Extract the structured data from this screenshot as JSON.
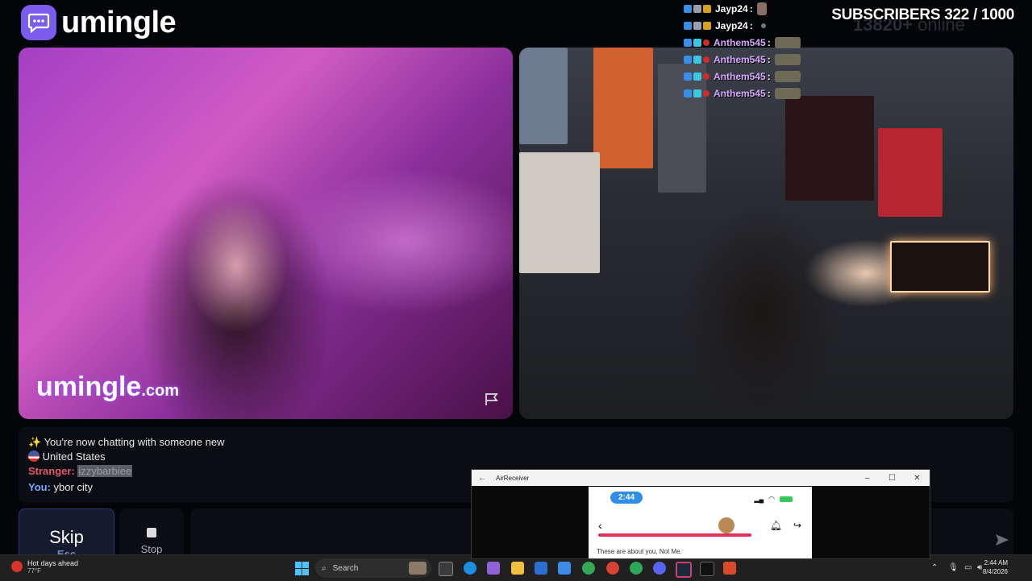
{
  "header": {
    "brand": "umingle",
    "online_count": "13820+",
    "online_word": "online",
    "subscribers": "SUBSCRIBERS 322 / 1000"
  },
  "overlay_chat": [
    {
      "name": "Jayp24",
      "sep": ":",
      "color": "#ffffff"
    },
    {
      "name": "Jayp24",
      "sep": ":",
      "color": "#ffffff"
    },
    {
      "name": "Anthem545",
      "sep": ":",
      "color": "#d9a8ff"
    },
    {
      "name": "Anthem545",
      "sep": ":",
      "color": "#d9a8ff"
    },
    {
      "name": "Anthem545",
      "sep": ":",
      "color": "#d9a8ff"
    },
    {
      "name": "Anthem545",
      "sep": ":",
      "color": "#d9a8ff"
    }
  ],
  "video_left": {
    "watermark_main": "umingle",
    "watermark_suffix": ".com",
    "report_icon": "flag-icon"
  },
  "chat": {
    "system_message": "You're now chatting with someone new",
    "system_icon": "sparkle-icon",
    "country": "United States",
    "country_icon": "us-flag-icon",
    "stranger_label": "Stranger:",
    "stranger_handle": "izzybarbiee",
    "you_label": "You:",
    "you_message": "ybor city"
  },
  "controls": {
    "skip_label": "Skip",
    "skip_key": "Esc",
    "stop_label": "Stop",
    "send_icon": "send-icon"
  },
  "air_receiver": {
    "title": "AirReceiver",
    "phone_time": "2:44",
    "phone_caption": "These are about you, Not Me."
  },
  "taskbar": {
    "weather_title": "Hot days ahead",
    "weather_temp": "77°F",
    "search_placeholder": "Search",
    "time": "2:44 AM",
    "date": "8/4/2026"
  },
  "colors": {
    "brand": "#7b5cf0",
    "stranger": "#e25b6a",
    "you": "#7aa8ff",
    "skip_bg": "#151b2f"
  }
}
